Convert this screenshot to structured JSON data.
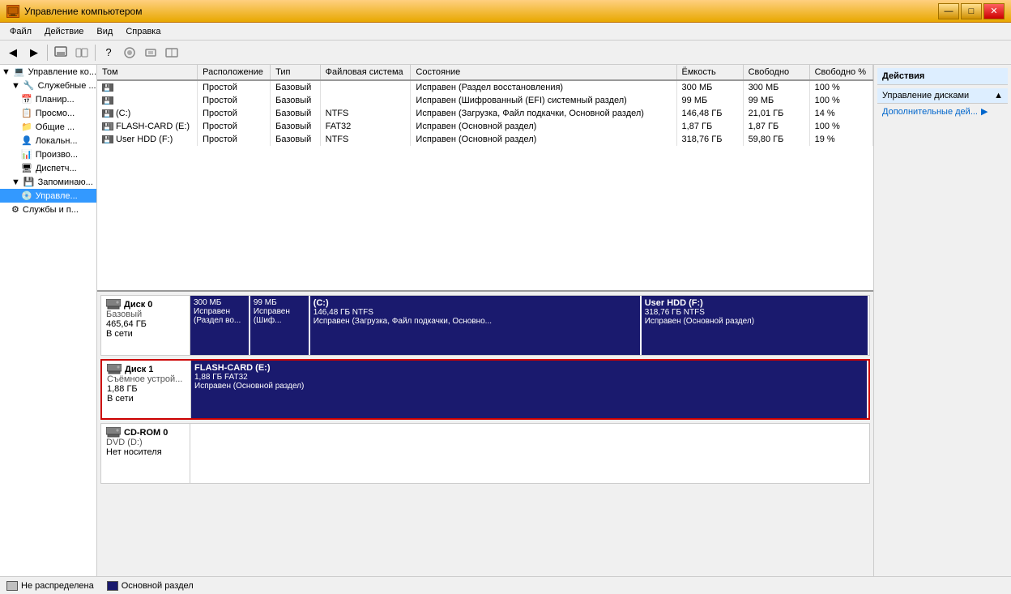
{
  "titlebar": {
    "title": "Управление компьютером",
    "minimize": "—",
    "maximize": "□",
    "close": "✕"
  },
  "menubar": {
    "items": [
      "Файл",
      "Действие",
      "Вид",
      "Справка"
    ]
  },
  "sidebar": {
    "items": [
      {
        "label": "Управление ко...",
        "level": 0,
        "expanded": true,
        "icon": "computer"
      },
      {
        "label": "Служебные ...",
        "level": 1,
        "expanded": true,
        "icon": "folder"
      },
      {
        "label": "Планир...",
        "level": 2,
        "icon": "task"
      },
      {
        "label": "Просмо...",
        "level": 2,
        "icon": "viewer"
      },
      {
        "label": "Общие ...",
        "level": 2,
        "icon": "shared"
      },
      {
        "label": "Локальн...",
        "level": 2,
        "icon": "local"
      },
      {
        "label": "Произво...",
        "level": 2,
        "icon": "perf"
      },
      {
        "label": "Диспетч...",
        "level": 2,
        "icon": "device"
      },
      {
        "label": "Запоминаю...",
        "level": 1,
        "expanded": true,
        "icon": "storage"
      },
      {
        "label": "Управле...",
        "level": 2,
        "icon": "disk",
        "selected": true
      },
      {
        "label": "Службы и п...",
        "level": 1,
        "icon": "services"
      }
    ]
  },
  "table": {
    "columns": [
      "Том",
      "Расположение",
      "Тип",
      "Файловая система",
      "Состояние",
      "Ёмкость",
      "Свободно",
      "Свободно %"
    ],
    "rows": [
      {
        "vol": "",
        "loc": "Простой",
        "type": "Базовый",
        "fs": "",
        "status": "Исправен (Раздел восстановления)",
        "capacity": "300 МБ",
        "free": "300 МБ",
        "freepct": "100 %",
        "icon": "hdd"
      },
      {
        "vol": "",
        "loc": "Простой",
        "type": "Базовый",
        "fs": "",
        "status": "Исправен (Шифрованный (EFI) системный раздел)",
        "capacity": "99 МБ",
        "free": "99 МБ",
        "freepct": "100 %",
        "icon": "hdd"
      },
      {
        "vol": "(C:)",
        "loc": "Простой",
        "type": "Базовый",
        "fs": "NTFS",
        "status": "Исправен (Загрузка, Файл подкачки, Основной раздел)",
        "capacity": "146,48 ГБ",
        "free": "21,01 ГБ",
        "freepct": "14 %",
        "icon": "hdd"
      },
      {
        "vol": "FLASH-CARD (E:)",
        "loc": "Простой",
        "type": "Базовый",
        "fs": "FAT32",
        "status": "Исправен (Основной раздел)",
        "capacity": "1,87 ГБ",
        "free": "1,87 ГБ",
        "freepct": "100 %",
        "icon": "flash"
      },
      {
        "vol": "User HDD (F:)",
        "loc": "Простой",
        "type": "Базовый",
        "fs": "NTFS",
        "status": "Исправен (Основной раздел)",
        "capacity": "318,76 ГБ",
        "free": "59,80 ГБ",
        "freepct": "19 %",
        "icon": "hdd"
      }
    ]
  },
  "disks": [
    {
      "id": "disk0",
      "name": "Диск 0",
      "type": "Базовый",
      "size": "465,64 ГБ",
      "status": "В сети",
      "highlighted": false,
      "partitions": [
        {
          "name": "",
          "size": "300 МБ",
          "fs": "",
          "status": "Исправен (Раздел во...",
          "width": 8
        },
        {
          "name": "",
          "size": "99 МБ",
          "fs": "",
          "status": "Исправен (Шиф...",
          "width": 8
        },
        {
          "name": "(C:)",
          "size": "146,48 ГБ NTFS",
          "fs": "NTFS",
          "status": "Исправен (Загрузка, Файл подкачки, Основно...",
          "width": 50
        },
        {
          "name": "User HDD  (F:)",
          "size": "318,76 ГБ NTFS",
          "fs": "NTFS",
          "status": "Исправен (Основной раздел)",
          "width": 34
        }
      ]
    },
    {
      "id": "disk1",
      "name": "Диск 1",
      "type": "Съёмное устрой...",
      "size": "1,88 ГБ",
      "status": "В сети",
      "highlighted": true,
      "partitions": [
        {
          "name": "FLASH-CARD  (E:)",
          "size": "1,88 ГБ FAT32",
          "fs": "FAT32",
          "status": "Исправен (Основной раздел)",
          "width": 100
        }
      ]
    },
    {
      "id": "cdrom0",
      "name": "CD-ROM 0",
      "type": "DVD (D:)",
      "size": "",
      "status": "Нет носителя",
      "highlighted": false,
      "partitions": []
    }
  ],
  "actions": {
    "title": "Действия",
    "section": "Управление дисками",
    "items": [
      "Дополнительные дей..."
    ]
  },
  "legend": {
    "items": [
      "Не распределена",
      "Основной раздел"
    ]
  }
}
